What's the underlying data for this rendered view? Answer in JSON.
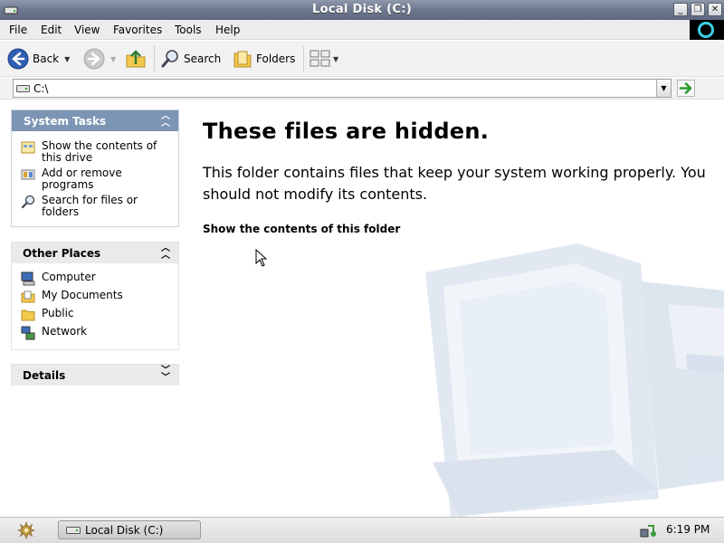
{
  "window": {
    "title": "Local Disk (C:)"
  },
  "menu": [
    "File",
    "Edit",
    "View",
    "Favorites",
    "Tools",
    "Help"
  ],
  "toolbar": {
    "back_label": "Back",
    "search_label": "Search",
    "folders_label": "Folders"
  },
  "address": {
    "value": "C:\\"
  },
  "system_tasks": {
    "title": "System Tasks",
    "items": [
      {
        "label": "Show the contents of this drive",
        "icon": "folder-view-icon"
      },
      {
        "label": "Add or remove programs",
        "icon": "programs-icon"
      },
      {
        "label": "Search for files or folders",
        "icon": "search-icon"
      }
    ]
  },
  "other_places": {
    "title": "Other Places",
    "items": [
      {
        "label": "Computer",
        "icon": "computer-icon"
      },
      {
        "label": "My Documents",
        "icon": "documents-icon"
      },
      {
        "label": "Public",
        "icon": "folder-icon"
      },
      {
        "label": "Network",
        "icon": "network-icon"
      }
    ]
  },
  "details": {
    "title": "Details"
  },
  "main": {
    "heading": "These files are hidden.",
    "description": "This folder contains files that keep your system working properly. You should not modify its contents.",
    "show_link": "Show the contents of this folder"
  },
  "taskbar": {
    "task_label": "Local Disk (C:)",
    "clock": "6:19 PM"
  },
  "colors": {
    "titlebar": "#6d778e",
    "panel_blue": "#7d95b5",
    "brand_ring": "#3bd0e6"
  }
}
